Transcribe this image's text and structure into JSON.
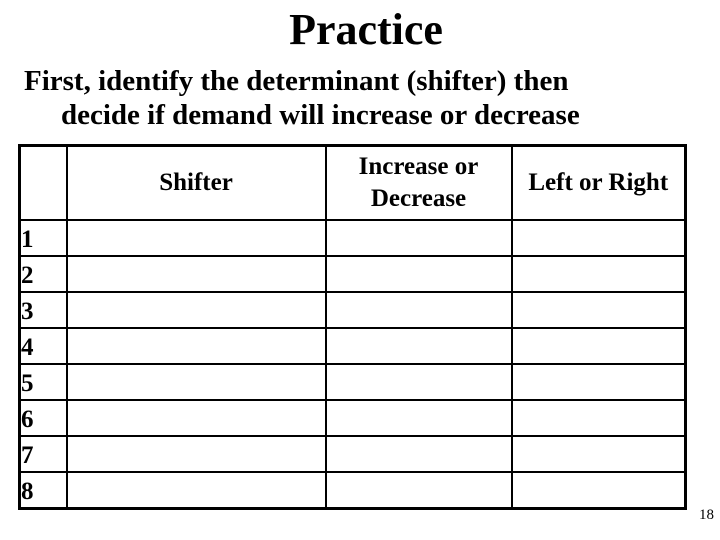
{
  "slide": {
    "title": "Practice",
    "subtitle_line1": "First, identify the determinant (shifter) then",
    "subtitle_line2": "decide if demand will increase or decrease",
    "page_number": "18"
  },
  "table": {
    "headers": [
      "",
      "Shifter",
      "Increase or Decrease",
      "Left or Right"
    ],
    "rows": [
      {
        "num": "1",
        "shifter": "",
        "change": "",
        "direction": ""
      },
      {
        "num": "2",
        "shifter": "",
        "change": "",
        "direction": ""
      },
      {
        "num": "3",
        "shifter": "",
        "change": "",
        "direction": ""
      },
      {
        "num": "4",
        "shifter": "",
        "change": "",
        "direction": ""
      },
      {
        "num": "5",
        "shifter": "",
        "change": "",
        "direction": ""
      },
      {
        "num": "6",
        "shifter": "",
        "change": "",
        "direction": ""
      },
      {
        "num": "7",
        "shifter": "",
        "change": "",
        "direction": ""
      },
      {
        "num": "8",
        "shifter": "",
        "change": "",
        "direction": ""
      }
    ]
  }
}
